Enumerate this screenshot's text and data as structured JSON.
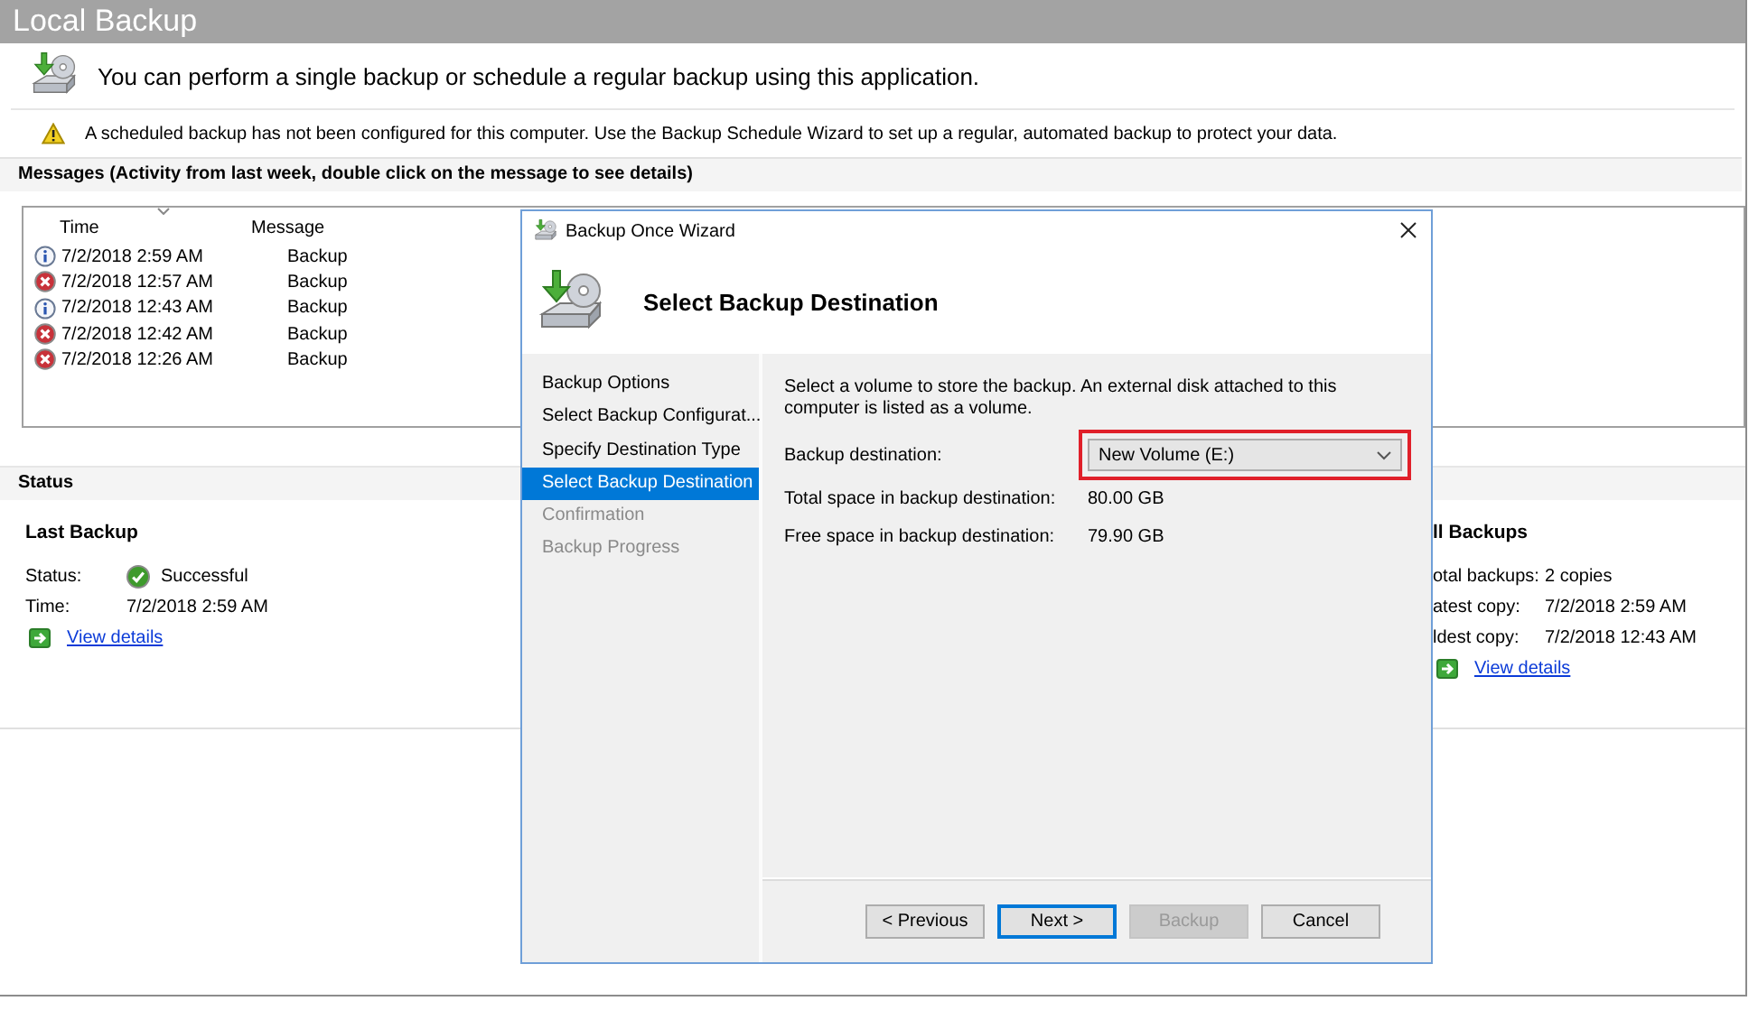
{
  "app": {
    "title": "Local Backup",
    "intro": "You can perform a single backup or schedule a regular backup using this application.",
    "warning": "A scheduled backup has not been configured for this computer. Use the Backup Schedule Wizard to set up a regular, automated backup to protect your data.",
    "messages_header": "Messages (Activity from last week, double click on the message to see details)",
    "messages": {
      "columns": [
        "Time",
        "Message"
      ],
      "rows": [
        {
          "kind": "info",
          "time": "7/2/2018 2:59 AM",
          "message": "Backup"
        },
        {
          "kind": "error",
          "time": "7/2/2018 12:57 AM",
          "message": "Backup"
        },
        {
          "kind": "info",
          "time": "7/2/2018 12:43 AM",
          "message": "Backup"
        },
        {
          "kind": "error",
          "time": "7/2/2018 12:42 AM",
          "message": "Backup"
        },
        {
          "kind": "error",
          "time": "7/2/2018 12:26 AM",
          "message": "Backup"
        }
      ]
    },
    "status": {
      "title": "Status",
      "last_backup": {
        "title": "Last Backup",
        "fields": [
          {
            "kind": "status",
            "label": "Status:",
            "value": "Successful"
          },
          {
            "label": "Time:",
            "value": "7/2/2018 2:59 AM"
          }
        ],
        "link": "View details"
      },
      "all_backups": {
        "title": "ll Backups",
        "fields": [
          {
            "label": "otal backups:",
            "value": "2 copies"
          },
          {
            "label": "atest copy:",
            "value": "7/2/2018 2:59 AM"
          },
          {
            "label": "ldest copy:",
            "value": "7/2/2018 12:43 AM"
          }
        ],
        "link": "View details"
      }
    }
  },
  "dialog": {
    "title": "Backup Once Wizard",
    "heading": "Select Backup Destination",
    "steps": [
      {
        "label": "Backup Options",
        "selected": false,
        "disabled": false
      },
      {
        "label": "Select Backup Configurat...",
        "selected": false,
        "disabled": false
      },
      {
        "label": "Specify Destination Type",
        "selected": false,
        "disabled": false
      },
      {
        "label": "Select Backup Destination",
        "selected": true,
        "disabled": false
      },
      {
        "label": "Confirmation",
        "selected": false,
        "disabled": true
      },
      {
        "label": "Backup Progress",
        "selected": false,
        "disabled": true
      }
    ],
    "description": "Select a volume to store the backup. An external disk attached to this computer is listed as a volume.",
    "destination": {
      "label": "Backup destination:",
      "value": "New Volume (E:)",
      "highlighted": true
    },
    "info": [
      {
        "label": "Total space in backup destination:",
        "value": "80.00 GB"
      },
      {
        "label": "Free space in backup destination:",
        "value": "79.90 GB"
      }
    ],
    "buttons": [
      {
        "label": "< Previous",
        "disabled": false,
        "default": false
      },
      {
        "label": "Next >",
        "disabled": false,
        "default": true
      },
      {
        "label": "Backup",
        "disabled": true,
        "default": false
      },
      {
        "label": "Cancel",
        "disabled": false,
        "default": false
      }
    ]
  }
}
